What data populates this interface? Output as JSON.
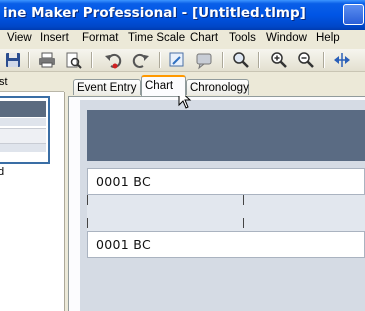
{
  "app": {
    "title": "ine Maker Professional - [Untitled.tlmp]"
  },
  "menu": [
    "View",
    "Insert",
    "Format",
    "Time Scale",
    "Chart",
    "Tools",
    "Window",
    "Help"
  ],
  "left_panel": {
    "header": "st",
    "label": "d"
  },
  "tabs": [
    "Event Entry",
    "Chart",
    "Chronology"
  ],
  "active_tab": "Chart",
  "chart_rows": [
    "0001 BC",
    "0001 BC"
  ],
  "toolbar_icons": [
    "save-icon",
    "print-icon",
    "print-preview-icon",
    "undo-icon",
    "redo-icon",
    "add-event-icon",
    "comment-icon",
    "find-icon",
    "zoom-in-icon",
    "zoom-out-icon",
    "fit-width-icon"
  ]
}
